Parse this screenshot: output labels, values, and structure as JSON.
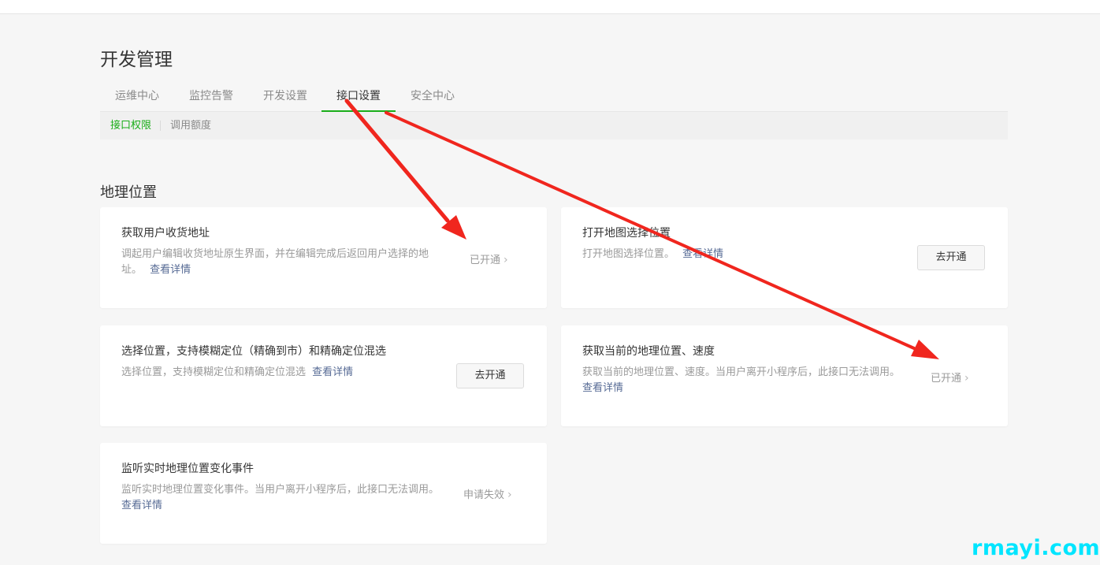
{
  "page": {
    "title": "开发管理"
  },
  "tabs": [
    {
      "label": "运维中心"
    },
    {
      "label": "监控告警"
    },
    {
      "label": "开发设置"
    },
    {
      "label": "接口设置"
    },
    {
      "label": "安全中心"
    }
  ],
  "active_tab": "接口设置",
  "subtabs": [
    {
      "label": "接口权限"
    },
    {
      "label": "调用额度"
    }
  ],
  "active_subtab": "接口权限",
  "section": {
    "title": "地理位置"
  },
  "cards": [
    {
      "title": "获取用户收货地址",
      "desc_line1": "调起用户编辑收货地址原生界面，并在编辑完成后返回用户选择的地",
      "desc_line2": "址。",
      "detail": "查看详情",
      "status": "已开通"
    },
    {
      "title": "打开地图选择位置",
      "desc_line1": "打开地图选择位置。",
      "detail": "查看详情",
      "button": "去开通"
    },
    {
      "title": "选择位置，支持模糊定位（精确到市）和精确定位混选",
      "desc_line1": "选择位置，支持模糊定位和精确定位混选",
      "detail": "查看详情",
      "button": "去开通"
    },
    {
      "title": "获取当前的地理位置、速度",
      "desc_line1": "获取当前的地理位置、速度。当用户离开小程序后，此接口无法调用。",
      "detail": "查看详情",
      "status": "已开通"
    },
    {
      "title": "监听实时地理位置变化事件",
      "desc_line1": "监听实时地理位置变化事件。当用户离开小程序后，此接口无法调用。",
      "detail": "查看详情",
      "status": "申请失效"
    }
  ],
  "icons": {
    "status_chevron": "chevron-right-icon"
  },
  "colors": {
    "accent": "#1aad19",
    "link": "#576b95",
    "annotation_arrow": "#f0261e",
    "watermark": "#00e5ff"
  },
  "watermark": "rmayi.com"
}
